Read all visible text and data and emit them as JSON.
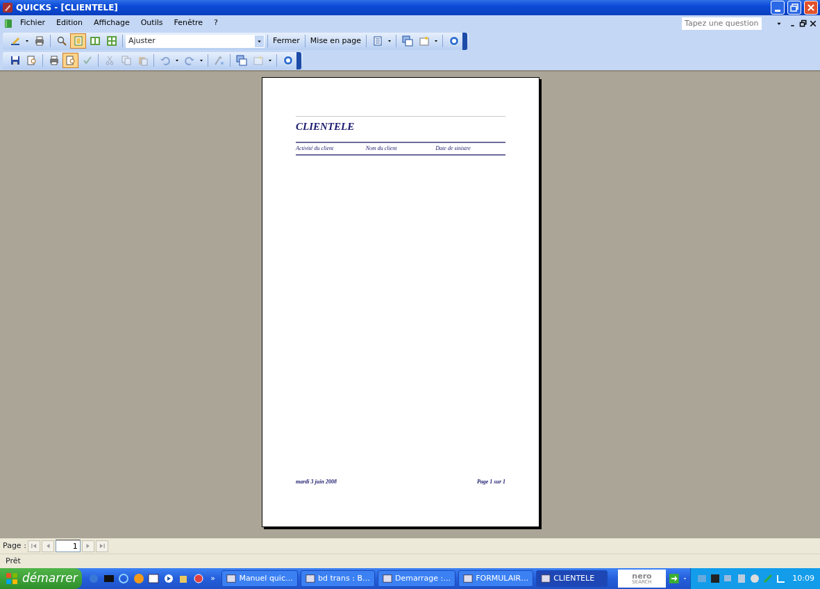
{
  "window": {
    "title": "QUICKS - [CLIENTELE]"
  },
  "menu": [
    {
      "label": "Fichier"
    },
    {
      "label": "Edition"
    },
    {
      "label": "Affichage"
    },
    {
      "label": "Outils"
    },
    {
      "label": "Fenêtre"
    },
    {
      "label": "?"
    }
  ],
  "help_box": {
    "placeholder": "Tapez une question"
  },
  "toolbar_1": [
    {
      "kind": "icon",
      "selected": false,
      "disabled": false
    },
    {
      "kind": "dropdown"
    },
    {
      "kind": "icon",
      "selected": false,
      "disabled": false
    },
    {
      "kind": "separator"
    },
    {
      "kind": "icon",
      "selected": false,
      "disabled": false
    },
    {
      "kind": "icon",
      "selected": true,
      "disabled": false
    },
    {
      "kind": "icon",
      "selected": false,
      "disabled": false
    },
    {
      "kind": "icon",
      "selected": false,
      "disabled": false
    },
    {
      "kind": "separator"
    },
    {
      "kind": "combo",
      "value": "Ajuster"
    },
    {
      "kind": "separator"
    },
    {
      "kind": "button",
      "label": "Fermer"
    },
    {
      "kind": "separator"
    },
    {
      "kind": "button",
      "label": "Mise en page"
    },
    {
      "kind": "separator"
    },
    {
      "kind": "icon",
      "selected": false,
      "disabled": false
    },
    {
      "kind": "dropdown"
    },
    {
      "kind": "separator"
    },
    {
      "kind": "icon",
      "selected": false,
      "disabled": false
    },
    {
      "kind": "icon",
      "selected": false,
      "disabled": false
    },
    {
      "kind": "dropdown"
    },
    {
      "kind": "separator"
    },
    {
      "kind": "icon",
      "selected": false,
      "disabled": false
    }
  ],
  "toolbar_2": [
    {
      "kind": "icon",
      "selected": false,
      "disabled": false
    },
    {
      "kind": "icon",
      "selected": false,
      "disabled": false
    },
    {
      "kind": "separator"
    },
    {
      "kind": "icon",
      "selected": false,
      "disabled": false
    },
    {
      "kind": "icon",
      "selected": true,
      "disabled": false
    },
    {
      "kind": "icon",
      "selected": false,
      "disabled": true
    },
    {
      "kind": "separator"
    },
    {
      "kind": "icon",
      "selected": false,
      "disabled": true
    },
    {
      "kind": "icon",
      "selected": false,
      "disabled": true
    },
    {
      "kind": "icon",
      "selected": false,
      "disabled": true
    },
    {
      "kind": "separator"
    },
    {
      "kind": "icon",
      "selected": false,
      "disabled": true
    },
    {
      "kind": "dropdown"
    },
    {
      "kind": "icon",
      "selected": false,
      "disabled": true
    },
    {
      "kind": "dropdown"
    },
    {
      "kind": "separator"
    },
    {
      "kind": "icon",
      "selected": false,
      "disabled": true
    },
    {
      "kind": "separator"
    },
    {
      "kind": "icon",
      "selected": false,
      "disabled": false
    },
    {
      "kind": "icon",
      "selected": false,
      "disabled": true
    },
    {
      "kind": "dropdown"
    },
    {
      "kind": "separator"
    },
    {
      "kind": "icon",
      "selected": false,
      "disabled": false
    }
  ],
  "report": {
    "title": "CLIENTELE",
    "columns": [
      "Activité du client",
      "Nom du client",
      "Date de sinistre"
    ],
    "footer_date": "mardi 3 juin 2008",
    "footer_page": "Page 1 sur 1"
  },
  "page_nav": {
    "label": "Page :",
    "value": "1"
  },
  "status_bar": {
    "text": "Prêt"
  },
  "taskbar": {
    "start": "démarrer",
    "more": "»",
    "tasks": [
      {
        "label": "Manuel quic…",
        "selected": false
      },
      {
        "label": "bd trans : B…",
        "selected": false
      },
      {
        "label": "Demarrage :…",
        "selected": false
      },
      {
        "label": "FORMULAIR…",
        "selected": false
      },
      {
        "label": "CLIENTELE",
        "selected": true
      }
    ],
    "search_logo": {
      "top": "nero",
      "bottom": "SEARCH"
    },
    "clock": "10:09"
  }
}
